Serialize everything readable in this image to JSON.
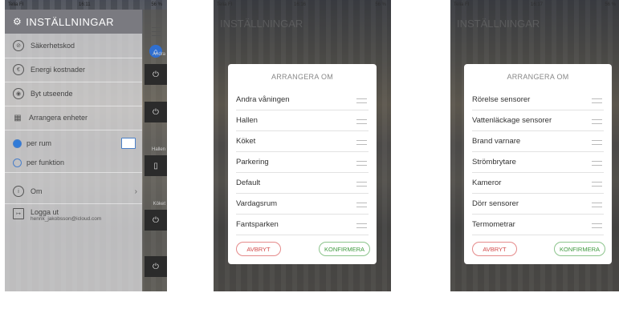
{
  "screen1": {
    "status": {
      "carrier": "Telia FI",
      "time": "16:11",
      "battery": "56 %"
    },
    "header": {
      "title": "INSTÄLLNINGAR"
    },
    "menu": [
      {
        "label": "Säkerhetskod",
        "icon": "lock-icon"
      },
      {
        "label": "Energi kostnader",
        "icon": "energy-icon"
      },
      {
        "label": "Byt utseende",
        "icon": "palette-icon"
      },
      {
        "label": "Arrangera enheter",
        "icon": "grid-icon"
      }
    ],
    "radios": [
      {
        "label": "per rum",
        "selected": true
      },
      {
        "label": "per funktion",
        "selected": false
      }
    ],
    "about": {
      "label": "Om"
    },
    "logout": {
      "label": "Logga ut",
      "email": "henrik_jakobsson@icloud.com"
    },
    "side_labels": {
      "room1": "Andra",
      "room2": "Hallen",
      "room3": "Köket"
    }
  },
  "screen2": {
    "status": {
      "carrier": "Telia FI",
      "time": "16:16",
      "battery": "56 %"
    },
    "dialog": {
      "title": "ARRANGERA OM",
      "items": [
        "Andra våningen",
        "Hallen",
        "Köket",
        "Parkering",
        "Default",
        "Vardagsrum",
        "Fantsparken"
      ],
      "cancel": "AVBRYT",
      "confirm": "KONFIRMERA"
    }
  },
  "screen3": {
    "status": {
      "carrier": "Telia FI",
      "time": "16:17",
      "battery": "56 %"
    },
    "dialog": {
      "title": "ARRANGERA OM",
      "items": [
        "Rörelse sensorer",
        "Vattenläckage sensorer",
        "Brand varnare",
        "Strömbrytare",
        "Kameror",
        "Dörr sensorer",
        "Termometrar"
      ],
      "cancel": "AVBRYT",
      "confirm": "KONFIRMERA"
    }
  },
  "colors": {
    "accent": "#2f7ad8",
    "cancel": "#d24a4a",
    "confirm": "#3f9a3f"
  }
}
